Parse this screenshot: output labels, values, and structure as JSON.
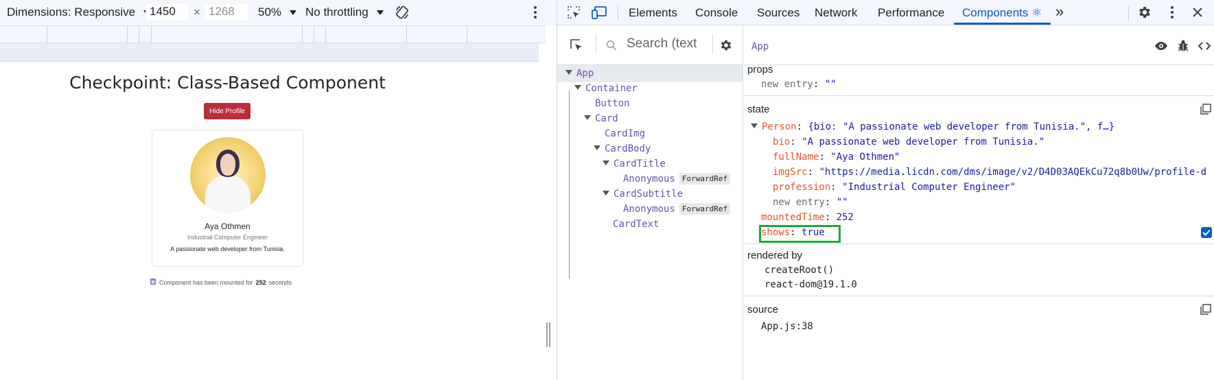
{
  "device_toolbar": {
    "dimensions_label": "Dimensions: Responsive",
    "width_value": "1450",
    "times_sign": "×",
    "height_placeholder": "1268",
    "zoom": "50%",
    "throttling": "No throttling"
  },
  "app_page": {
    "title": "Checkpoint: Class-Based Component",
    "hide_button": "Hide Profile",
    "person": {
      "name": "Aya Othmen",
      "profession": "Industrial Computer Engineer",
      "bio": "A passionate web developer from Tunisia."
    },
    "mounted_prefix": "Component has been mounted for",
    "mounted_seconds": "252",
    "mounted_suffix": "seconds"
  },
  "devtools": {
    "tabs": [
      "Elements",
      "Console",
      "Sources",
      "Network",
      "Performance",
      "Components ⚛"
    ],
    "active_tab": "Components ⚛",
    "more_tabs": "»",
    "search_placeholder": "Search (text",
    "tree": [
      {
        "label": "App",
        "badge": ""
      },
      {
        "label": "Container",
        "badge": ""
      },
      {
        "label": "Button",
        "badge": ""
      },
      {
        "label": "Card",
        "badge": ""
      },
      {
        "label": "CardImg",
        "badge": ""
      },
      {
        "label": "CardBody",
        "badge": ""
      },
      {
        "label": "CardTitle",
        "badge": ""
      },
      {
        "label": "Anonymous",
        "badge": "ForwardRef"
      },
      {
        "label": "CardSubtitle",
        "badge": ""
      },
      {
        "label": "Anonymous",
        "badge": "ForwardRef"
      },
      {
        "label": "CardText",
        "badge": ""
      }
    ],
    "selected_component": "App",
    "props": {
      "title": "props",
      "new_entry_key": "new entry",
      "new_entry_value": "\"\""
    },
    "state": {
      "title": "state",
      "person_key": "Person",
      "person_summary": "{bio: \"A passionate web developer from Tunisia.\", f…}",
      "fields": [
        {
          "key": "bio",
          "value": "\"A passionate web developer from Tunisia.\""
        },
        {
          "key": "fullName",
          "value": "\"Aya Othmen\""
        },
        {
          "key": "imgSrc",
          "value": "\"https://media.licdn.com/dms/image/v2/D4D03AQEkCu72q8b0Uw/profile-d"
        },
        {
          "key": "profession",
          "value": "\"Industrial Computer Engineer\""
        }
      ],
      "new_entry_key": "new entry",
      "new_entry_value": "\"\"",
      "mounted_key": "mountedTime",
      "mounted_value": "252",
      "shows_key": "shows",
      "shows_value": "true"
    },
    "rendered_by": {
      "title": "rendered by",
      "items": [
        "createRoot()",
        "react-dom@19.1.0"
      ]
    },
    "source": {
      "title": "source",
      "file": "App.js:38"
    }
  },
  "colors": {
    "accent_blue": "#0b57d0",
    "component_purple": "#6a51b2",
    "key_red": "#e2552c",
    "value_blue": "#1a1aa6",
    "hide_button_red": "#bb2d3b",
    "highlight_green": "#1eaa3a"
  }
}
